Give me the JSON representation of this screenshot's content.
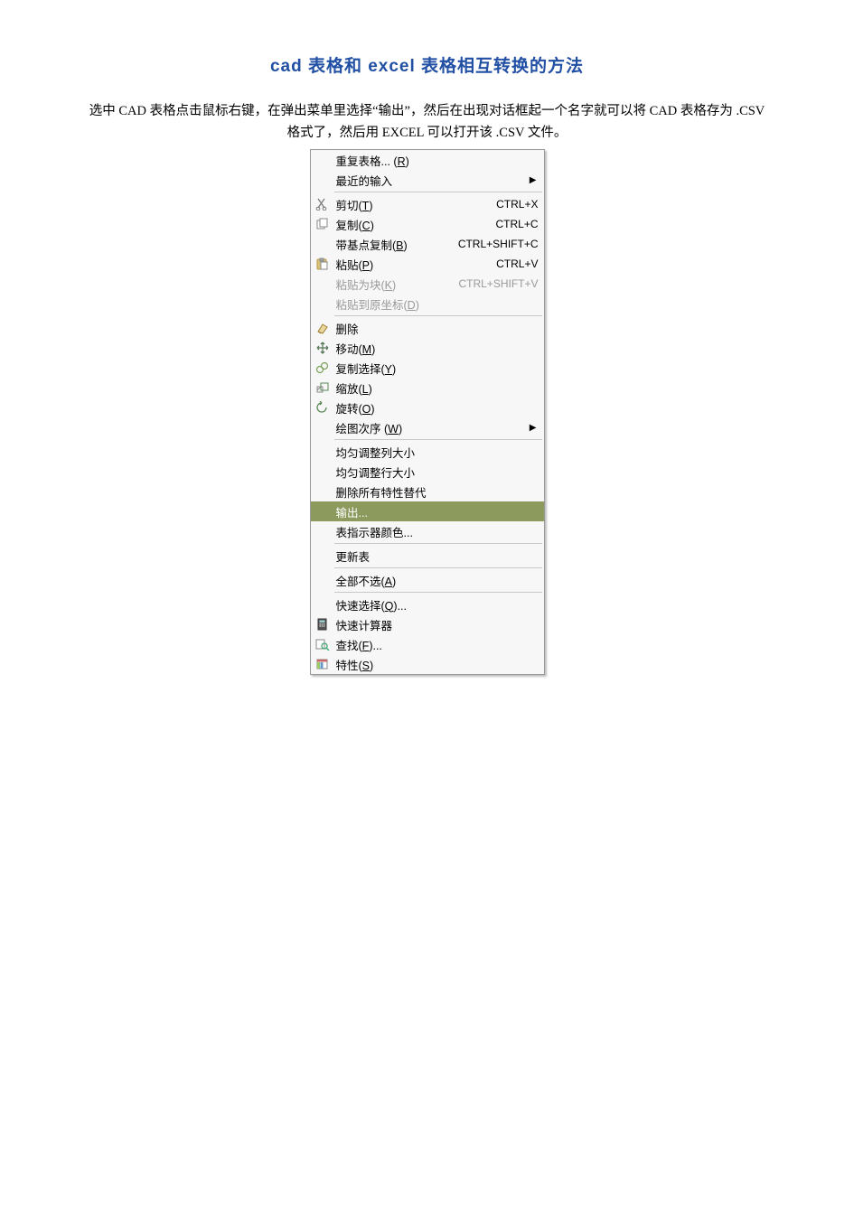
{
  "title": "cad 表格和 excel 表格相互转换的方法",
  "description": "选中 CAD 表格点击鼠标右键，在弹出菜单里选择“输出”，然后在出现对话框起一个名字就可以将 CAD 表格存为 .CSV 格式了，然后用 EXCEL 可以打开该 .CSV 文件。",
  "menu": {
    "g1": [
      {
        "label_pre": "重复表格... (",
        "hot": "R",
        "label_post": ")",
        "icon": null,
        "submenu": false
      },
      {
        "label_pre": "最近的输入",
        "hot": "",
        "label_post": "",
        "icon": null,
        "submenu": true
      }
    ],
    "g2": [
      {
        "label_pre": "剪切(",
        "hot": "T",
        "label_post": ")",
        "icon": "cut",
        "shortcut": "CTRL+X"
      },
      {
        "label_pre": "复制(",
        "hot": "C",
        "label_post": ")",
        "icon": "copy",
        "shortcut": "CTRL+C"
      },
      {
        "label_pre": "带基点复制(",
        "hot": "B",
        "label_post": ")",
        "icon": null,
        "shortcut": "CTRL+SHIFT+C"
      },
      {
        "label_pre": "粘贴(",
        "hot": "P",
        "label_post": ")",
        "icon": "paste",
        "shortcut": "CTRL+V"
      },
      {
        "label_pre": "粘贴为块(",
        "hot": "K",
        "label_post": ")",
        "icon": null,
        "shortcut": "CTRL+SHIFT+V",
        "disabled": true
      },
      {
        "label_pre": "粘贴到原坐标(",
        "hot": "D",
        "label_post": ")",
        "icon": null,
        "disabled": true
      }
    ],
    "g3": [
      {
        "label_pre": "删除",
        "hot": "",
        "label_post": "",
        "icon": "erase"
      },
      {
        "label_pre": "移动(",
        "hot": "M",
        "label_post": ")",
        "icon": "move"
      },
      {
        "label_pre": "复制选择(",
        "hot": "Y",
        "label_post": ")",
        "icon": "copysel"
      },
      {
        "label_pre": "缩放(",
        "hot": "L",
        "label_post": ")",
        "icon": "scale"
      },
      {
        "label_pre": "旋转(",
        "hot": "O",
        "label_post": ")",
        "icon": "rotate"
      },
      {
        "label_pre": "绘图次序 (",
        "hot": "W",
        "label_post": ")",
        "icon": null,
        "submenu": true
      }
    ],
    "g4": [
      {
        "label_pre": "均匀调整列大小",
        "hot": "",
        "label_post": "",
        "icon": null
      },
      {
        "label_pre": "均匀调整行大小",
        "hot": "",
        "label_post": "",
        "icon": null
      },
      {
        "label_pre": "删除所有特性替代",
        "hot": "",
        "label_post": "",
        "icon": null
      },
      {
        "label_pre": "输出...",
        "hot": "",
        "label_post": "",
        "icon": null,
        "highlight": true
      },
      {
        "label_pre": "表指示器颜色...",
        "hot": "",
        "label_post": "",
        "icon": null
      }
    ],
    "g5": [
      {
        "label_pre": "更新表",
        "hot": "",
        "label_post": "",
        "icon": null
      }
    ],
    "g6": [
      {
        "label_pre": "全部不选(",
        "hot": "A",
        "label_post": ")",
        "icon": null
      }
    ],
    "g7": [
      {
        "label_pre": "快速选择(",
        "hot": "Q",
        "label_post": ")...",
        "icon": null
      },
      {
        "label_pre": "快速计算器",
        "hot": "",
        "label_post": "",
        "icon": "calc"
      },
      {
        "label_pre": "查找(",
        "hot": "F",
        "label_post": ")...",
        "icon": "find"
      },
      {
        "label_pre": "特性(",
        "hot": "S",
        "label_post": ")",
        "icon": "props"
      }
    ]
  }
}
